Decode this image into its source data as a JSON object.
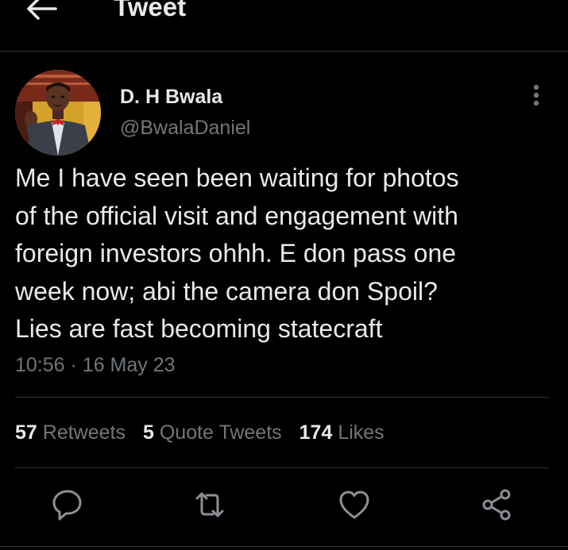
{
  "header": {
    "title": "Tweet",
    "back_icon": "arrow-left-icon"
  },
  "tweet": {
    "author": {
      "display_name": "D. H Bwala",
      "handle": "@BwalaDaniel"
    },
    "text_lines": [
      "Me I have seen been waiting for photos",
      "of the official visit and engagement with",
      "foreign investors ohhh. E don pass one",
      "week now; abi the camera don Spoil?",
      "Lies are fast becoming statecraft"
    ],
    "time": "10:56",
    "separator": "·",
    "date": "16 May 23"
  },
  "stats": {
    "retweets_count": "57",
    "retweets_label": "Retweets",
    "quotes_count": "5",
    "quotes_label": "Quote Tweets",
    "likes_count": "174",
    "likes_label": "Likes"
  },
  "actions": [
    "reply-icon",
    "retweet-icon",
    "like-icon",
    "share-icon"
  ],
  "colors": {
    "background": "#000000",
    "primary_text": "#e7e9ea",
    "secondary_text": "#71767b",
    "divider": "#2f3336"
  }
}
